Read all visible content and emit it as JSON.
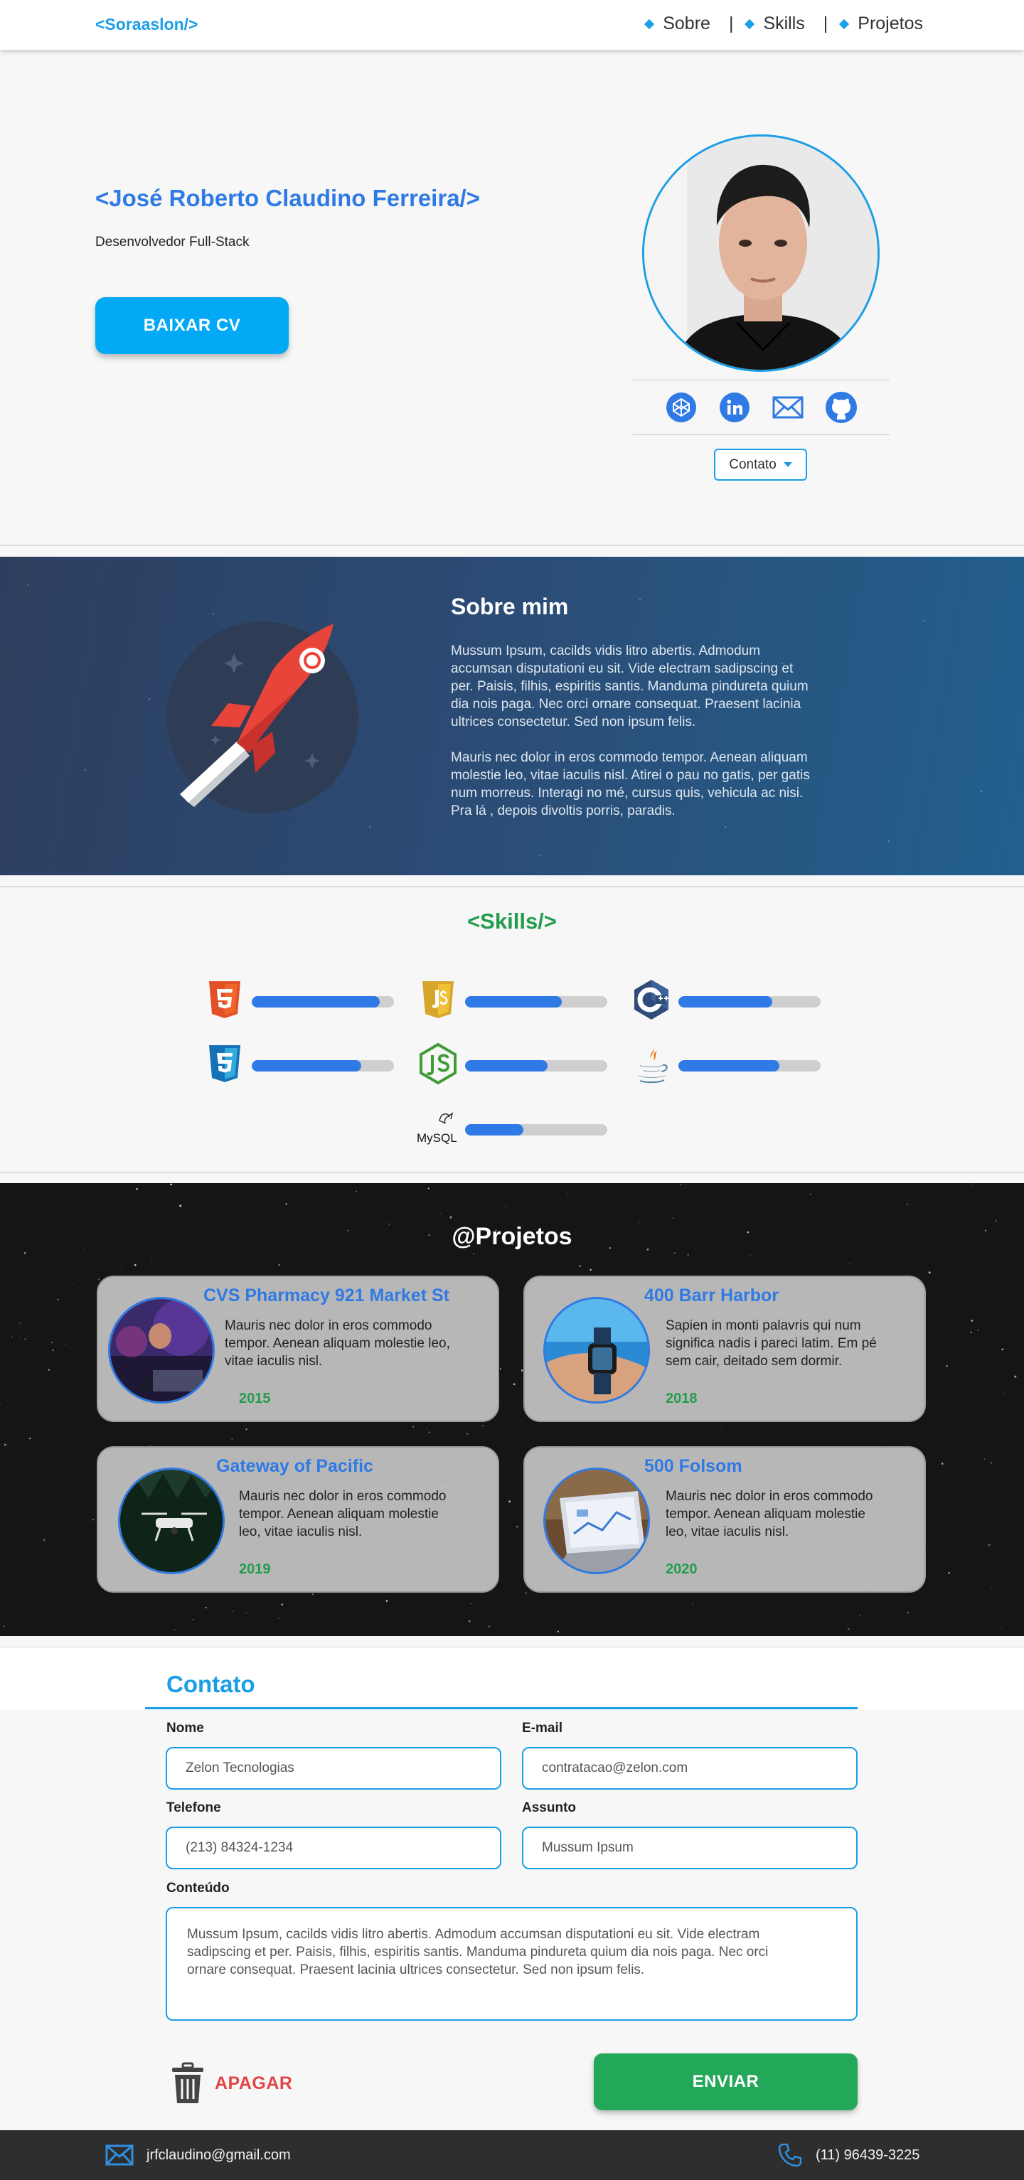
{
  "header": {
    "brand": "<Soraaslon/>",
    "nav": [
      {
        "label": "Sobre"
      },
      {
        "label": "Skills"
      },
      {
        "label": "Projetos"
      }
    ],
    "separator": "|"
  },
  "hero": {
    "name": "<José Roberto Claudino Ferreira/>",
    "role": "Desenvolvedor Full-Stack",
    "cv_button": "BAIXAR CV",
    "socials": [
      "codepen-icon",
      "linkedin-icon",
      "mail-icon",
      "github-icon"
    ],
    "contact_dropdown": "Contato"
  },
  "about": {
    "title": "Sobre mim",
    "p1_lines": [
      "Mussum Ipsum, cacilds vidis litro abertis. Admodum",
      "accumsan disputationi eu sit. Vide electram sadipscing et",
      "per. Paisis, filhis, espiritis santis. Manduma pindureta quium",
      "dia nois paga. Nec orci ornare consequat. Praesent lacinia",
      "ultrices consectetur. Sed non ipsum felis."
    ],
    "p2_lines": [
      "Mauris nec dolor in eros commodo tempor. Aenean aliquam",
      "molestie leo, vitae iaculis nisl. Atirei o pau no gatis, per gatis",
      "num morreus. Interagi no mé, cursus quis, vehicula ac nisi.",
      "Pra lá , depois divoltis porris, paradis."
    ]
  },
  "skills": {
    "title": "<Skills/>",
    "items": [
      {
        "name": "HTML5",
        "icon": "html5-icon",
        "level": 0.9
      },
      {
        "name": "JavaScript",
        "icon": "javascript-icon",
        "level": 0.68
      },
      {
        "name": "C++",
        "icon": "cpp-icon",
        "level": 0.66
      },
      {
        "name": "CSS3",
        "icon": "css3-icon",
        "level": 0.77
      },
      {
        "name": "Node.js",
        "icon": "nodejs-icon",
        "level": 0.58
      },
      {
        "name": "Java",
        "icon": "java-icon",
        "level": 0.71
      },
      {
        "name": "MySQL",
        "icon": "mysql-icon",
        "level": 0.41
      }
    ],
    "mysql_label": "MySQL"
  },
  "projects": {
    "title": "@Projetos",
    "cards": [
      {
        "title": "CVS Pharmacy 921 Market St",
        "desc_lines": [
          "Mauris nec dolor in eros commodo",
          "tempor. Aenean aliquam molestie leo,",
          "vitae iaculis nisl."
        ],
        "year": "2015"
      },
      {
        "title": "400 Barr Harbor",
        "desc_lines": [
          "Sapien in monti palavris qui num",
          "significa nadis i pareci latim. Em pé",
          "sem cair, deitado sem dormir."
        ],
        "year": "2018"
      },
      {
        "title": "Gateway of Pacific",
        "desc_lines": [
          "Mauris nec dolor in eros commodo",
          "tempor. Aenean aliquam molestie",
          "leo, vitae iaculis nisl."
        ],
        "year": "2019"
      },
      {
        "title": "500 Folsom",
        "desc_lines": [
          "Mauris nec dolor in eros commodo",
          "tempor. Aenean aliquam molestie",
          "leo, vitae iaculis nisl."
        ],
        "year": "2020"
      }
    ]
  },
  "contact": {
    "title": "Contato",
    "fields": {
      "name_label": "Nome",
      "name_value": "Zelon Tecnologias",
      "email_label": "E-mail",
      "email_value": "contratacao@zelon.com",
      "phone_label": "Telefone",
      "phone_value": "(213) 84324-1234",
      "subject_label": "Assunto",
      "subject_value": "Mussum Ipsum",
      "content_label": "Conteúdo",
      "content_lines": [
        "Mussum Ipsum, cacilds vidis litro abertis. Admodum accumsan disputationi eu sit. Vide electram",
        "sadipscing et per. Paisis, filhis, espiritis santis. Manduma pindureta quium dia nois paga. Nec orci",
        "ornare consequat. Praesent lacinia ultrices consectetur. Sed non ipsum felis."
      ]
    },
    "clear_button": "APAGAR",
    "send_button": "ENVIAR"
  },
  "footer": {
    "email": "jrfclaudino@gmail.com",
    "phone": "(11) 96439-3225"
  },
  "colors": {
    "accent": "#1a9ee6",
    "brand_blue": "#2f7ae5",
    "green": "#249c4d",
    "danger": "#e04646",
    "send": "#23a85a"
  }
}
